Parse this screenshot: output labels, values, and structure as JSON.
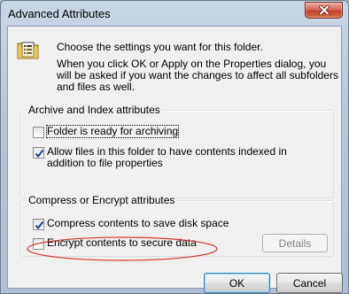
{
  "window": {
    "title": "Advanced Attributes"
  },
  "intro": {
    "line1": "Choose the settings you want for this folder.",
    "line2": "When you click OK or Apply on the Properties dialog, you will be asked if you want the changes to affect all subfolders and files as well."
  },
  "archive_group": {
    "label": "Archive and Index attributes",
    "archiving": {
      "label": "Folder is ready for archiving",
      "checked": false
    },
    "indexing": {
      "label": "Allow files in this folder to have contents indexed in addition to file properties",
      "checked": true
    }
  },
  "compress_group": {
    "label": "Compress or Encrypt attributes",
    "compress": {
      "label": "Compress contents to save disk space",
      "checked": true
    },
    "encrypt": {
      "label": "Encrypt contents to secure data",
      "checked": false
    },
    "details_label": "Details"
  },
  "buttons": {
    "ok": "OK",
    "cancel": "Cancel"
  },
  "icons": {
    "close": "close-icon",
    "folder": "folder-properties-icon"
  },
  "colors": {
    "annotation_ellipse": "#d9342b",
    "ok_focus_border": "#3c7fb1"
  }
}
